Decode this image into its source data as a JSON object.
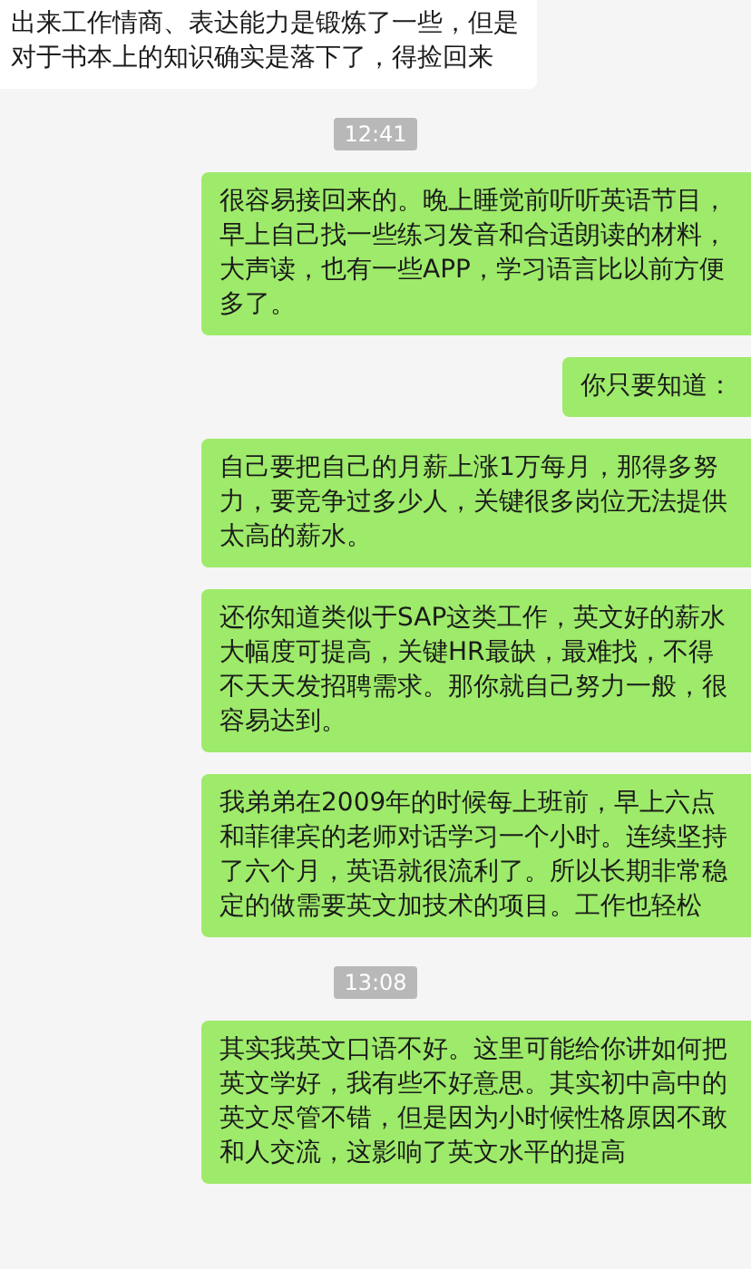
{
  "messages": [
    {
      "kind": "message",
      "outgoing": false,
      "text": "出来工作情商、表达能力是锻炼了一些，但是对于书本上的知识确实是落下了，得捡回来"
    },
    {
      "kind": "time",
      "text": "12:41"
    },
    {
      "kind": "message",
      "outgoing": true,
      "text": "很容易接回来的。晚上睡觉前听听英语节目，早上自己找一些练习发音和合适朗读的材料，大声读，也有一些APP，学习语言比以前方便多了。"
    },
    {
      "kind": "message",
      "outgoing": true,
      "text": "你只要知道："
    },
    {
      "kind": "message",
      "outgoing": true,
      "text": "自己要把自己的月薪上涨1万每月，那得多努力，要竞争过多少人，关键很多岗位无法提供太高的薪水。"
    },
    {
      "kind": "message",
      "outgoing": true,
      "text": "还你知道类似于SAP这类工作，英文好的薪水大幅度可提高，关键HR最缺，最难找，不得不天天发招聘需求。那你就自己努力一般，很容易达到。"
    },
    {
      "kind": "message",
      "outgoing": true,
      "text": "我弟弟在2009年的时候每上班前，早上六点和菲律宾的老师对话学习一个小时。连续坚持了六个月，英语就很流利了。所以长期非常稳定的做需要英文加技术的项目。工作也轻松"
    },
    {
      "kind": "time",
      "text": "13:08"
    },
    {
      "kind": "message",
      "outgoing": true,
      "text": "其实我英文口语不好。这里可能给你讲如何把英文学好，我有些不好意思。其实初中高中的英文尽管不错，但是因为小时候性格原因不敢和人交流，这影响了英文水平的提高"
    }
  ]
}
